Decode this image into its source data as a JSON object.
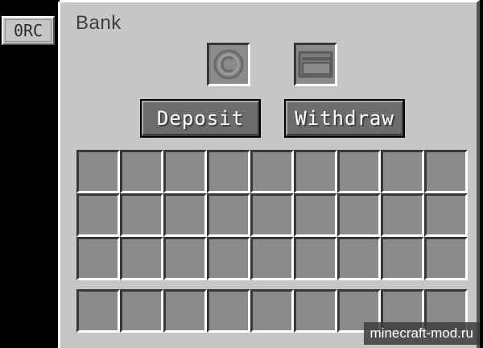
{
  "side_tab": {
    "label": "0RC"
  },
  "window": {
    "title": "Bank"
  },
  "slots": {
    "coin_icon": "coin-icon",
    "wallet_icon": "wallet-icon"
  },
  "buttons": {
    "deposit_label": "Deposit",
    "withdraw_label": "Withdraw"
  },
  "inventory": {
    "main_rows": 3,
    "columns": 9,
    "hotbar_rows": 1
  },
  "watermark": {
    "text": "minecraft-mod.ru"
  },
  "colors": {
    "panel_bg": "#c6c6c6",
    "slot_bg": "#8b8b8b",
    "button_bg": "#6c6c6c",
    "button_text": "#ffffff",
    "title_text": "#3f3f3f"
  }
}
